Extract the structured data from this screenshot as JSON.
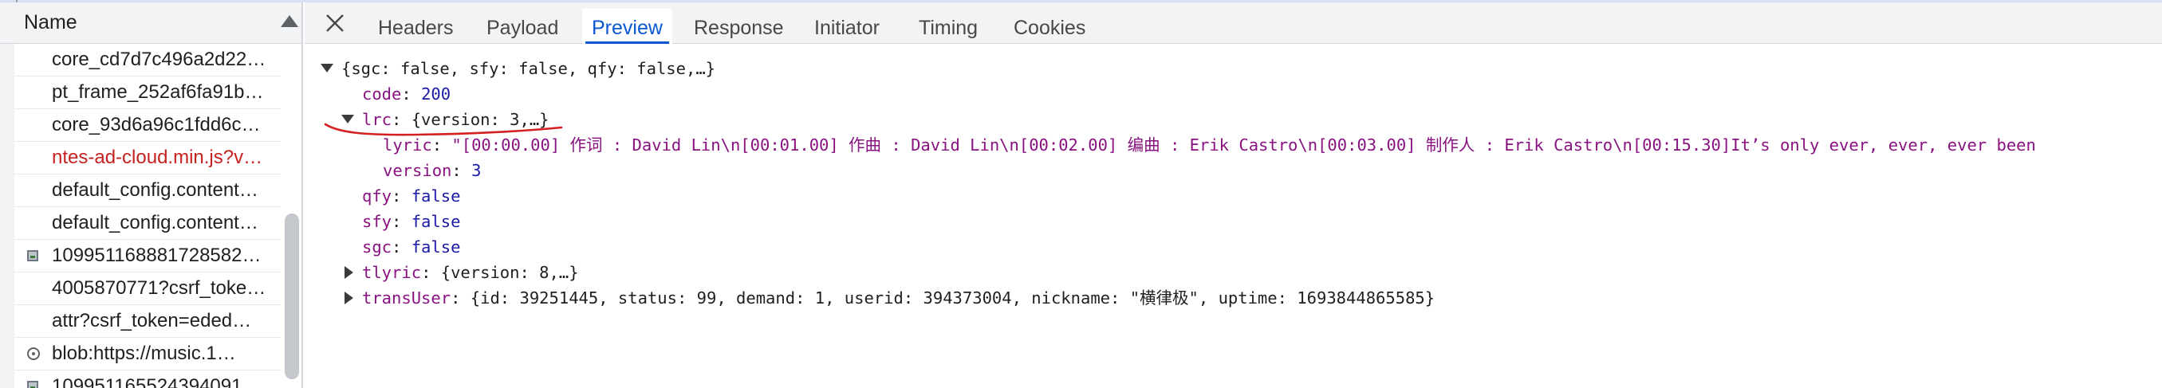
{
  "network_list": {
    "header": "Name",
    "rows": [
      {
        "label": "core_cd7d7c496a2d22…",
        "color": "#1f1f1f",
        "icon": null
      },
      {
        "label": "pt_frame_252af6fa91b…",
        "color": "#1f1f1f",
        "icon": null
      },
      {
        "label": "core_93d6a96c1fdd6c…",
        "color": "#1f1f1f",
        "icon": null
      },
      {
        "label": "ntes-ad-cloud.min.js?v…",
        "color": "#c5221f",
        "icon": null
      },
      {
        "label": "default_config.content…",
        "color": "#1f1f1f",
        "icon": null
      },
      {
        "label": "default_config.content…",
        "color": "#1f1f1f",
        "icon": null
      },
      {
        "label": "10995116888172858​2…",
        "color": "#1f1f1f",
        "icon": "image-icon"
      },
      {
        "label": "4005870771?csrf_toke…",
        "color": "#1f1f1f",
        "icon": null
      },
      {
        "label": "attr?csrf_token=eded…",
        "color": "#1f1f1f",
        "icon": null
      },
      {
        "label": "blob:https://music.1…",
        "color": "#1f1f1f",
        "icon": "gear-icon"
      },
      {
        "label": "10995116552439409​1…",
        "color": "#1f1f1f",
        "icon": "image-icon"
      }
    ]
  },
  "tabs": {
    "items": [
      {
        "label": "Headers",
        "active": false
      },
      {
        "label": "Payload",
        "active": false
      },
      {
        "label": "Preview",
        "active": true
      },
      {
        "label": "Response",
        "active": false
      },
      {
        "label": "Initiator",
        "active": false
      },
      {
        "label": "Timing",
        "active": false
      },
      {
        "label": "Cookies",
        "active": false
      }
    ]
  },
  "preview": {
    "root_summary": "{sgc: false, sfy: false, qfy: false,…}",
    "code": {
      "key": "code",
      "value": "200"
    },
    "lrc": {
      "key": "lrc",
      "summary": "{version: 3,…}",
      "lyric_key": "lyric",
      "lyric_value": "\"[00:00.00] 作词 : David Lin\\n[00:01.00] 作曲 : David Lin\\n[00:02.00] 编曲 : Erik Castro\\n[00:03.00] 制作人 : Erik Castro\\n[00:15.30]It’s only ever, ever, ever been",
      "version_key": "version",
      "version_value": "3"
    },
    "qfy": {
      "key": "qfy",
      "value": "false"
    },
    "sfy": {
      "key": "sfy",
      "value": "false"
    },
    "sgc": {
      "key": "sgc",
      "value": "false"
    },
    "tlyric": {
      "key": "tlyric",
      "summary": "{version: 8,…}"
    },
    "transUser": {
      "key": "transUser",
      "summary": "{id: 39251445, status: 99, demand: 1, userid: 394373004, nickname: \"横律极\", uptime: 1693844865585}"
    }
  },
  "colors": {
    "accent": "#0b57d0",
    "key": "#881280",
    "number": "#1a1aa6",
    "error_text": "#c5221f",
    "annotation_stroke": "#d42020"
  }
}
